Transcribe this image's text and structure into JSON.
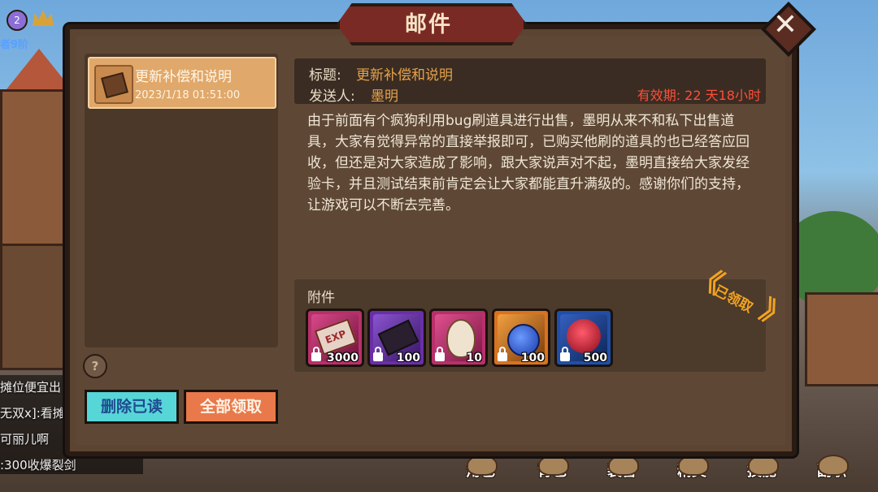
{
  "dialog": {
    "title": "邮件",
    "close_glyph": "✕"
  },
  "hud": {
    "rank_text": "者9阶",
    "badge_level": "2"
  },
  "chat": {
    "lines": [
      "摊位便宜出",
      "无双x]:看摊",
      "可丽儿啊",
      ":300收爆裂剑"
    ]
  },
  "mail_list": [
    {
      "title": "更新补偿和说明",
      "time": "2023/1/18 01:51:00",
      "icon": "envelope-icon",
      "selected": true
    }
  ],
  "buttons": {
    "delete_read": "删除已读",
    "claim_all": "全部领取",
    "help": "?"
  },
  "mail_detail": {
    "title_label": "标题:",
    "title_value": "更新补偿和说明",
    "sender_label": "发送人:",
    "sender_value": "墨明",
    "validity": "有效期: 22 天18小时",
    "body": "由于前面有个疯狗利用bug刷道具进行出售，墨明从来不和私下出售道具，大家有觉得异常的直接举报即可，已购买他刷的道具的也已经答应回收，但还是对大家造成了影响，跟大家说声对不起，墨明直接给大家发经验卡，并且测试结束前肯定会让大家都能直升满级的。感谢你们的支持，让游戏可以不断去完善。",
    "attachments_label": "附件",
    "claimed_stamp": "已领取"
  },
  "attachments": [
    {
      "icon": "exp-card-icon",
      "qty": "3000",
      "color": "#b8306a"
    },
    {
      "icon": "scroll-icon",
      "qty": "100",
      "color": "#6a2fa8"
    },
    {
      "icon": "egg-icon",
      "qty": "10",
      "color": "#b8306a"
    },
    {
      "icon": "potion-icon",
      "qty": "100",
      "color": "#d9731f"
    },
    {
      "icon": "red-gem-icon",
      "qty": "500",
      "color": "#1f4fa8"
    }
  ],
  "bottom_nav": [
    "角色",
    "背包",
    "装备",
    "精灵",
    "技能",
    "副职"
  ]
}
